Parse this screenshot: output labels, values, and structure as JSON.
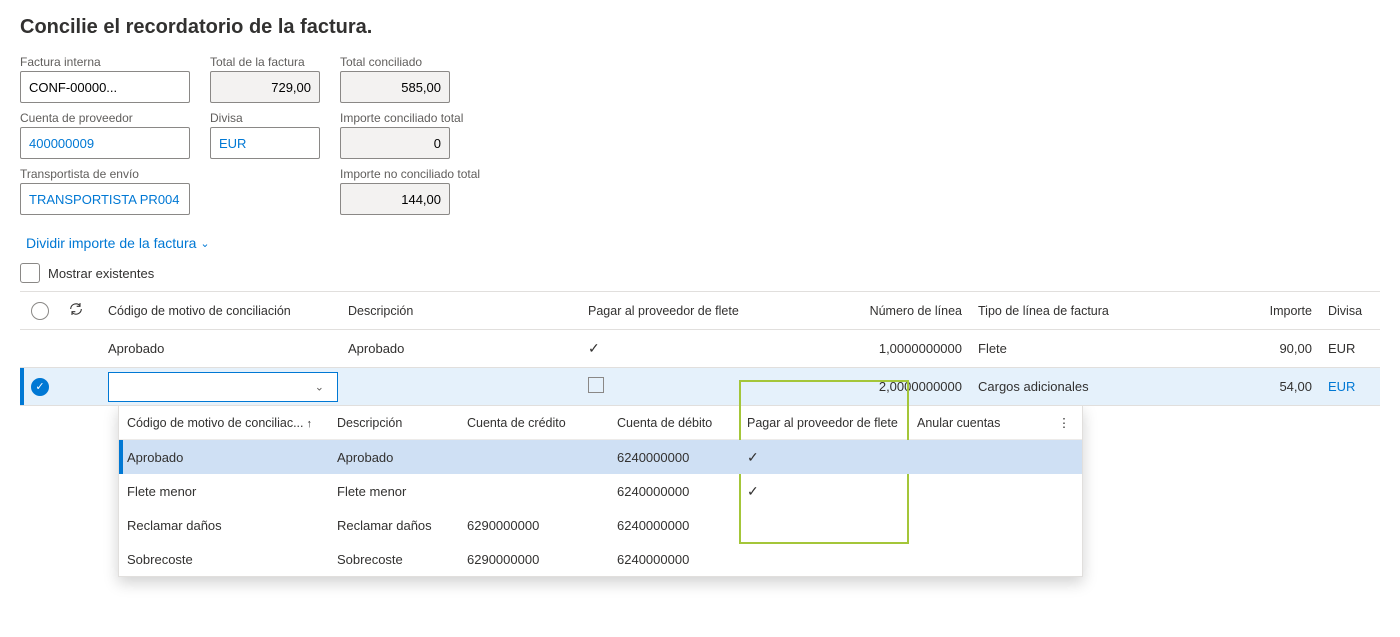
{
  "title": "Concilie el recordatorio de la factura.",
  "labels": {
    "factura_interna": "Factura interna",
    "total_factura": "Total de la factura",
    "total_conciliado": "Total conciliado",
    "cuenta_proveedor": "Cuenta de proveedor",
    "divisa": "Divisa",
    "importe_conc_total": "Importe conciliado total",
    "transportista": "Transportista de envío",
    "importe_no_conc_total": "Importe no conciliado total"
  },
  "values": {
    "factura_interna": "CONF-00000...",
    "total_factura": "729,00",
    "total_conciliado": "585,00",
    "cuenta_proveedor": "400000009",
    "divisa": "EUR",
    "importe_conc_total": "0",
    "transportista": "TRANSPORTISTA PR004",
    "importe_no_conc_total": "144,00"
  },
  "actions": {
    "dividir": "Dividir importe de la factura",
    "mostrar_existentes": "Mostrar existentes"
  },
  "grid": {
    "headers": {
      "codigo": "Código de motivo de conciliación",
      "descripcion": "Descripción",
      "pagar_flete": "Pagar al proveedor de flete",
      "numero_linea": "Número de línea",
      "tipo_linea": "Tipo de línea de factura",
      "importe": "Importe",
      "divisa": "Divisa"
    },
    "rows": [
      {
        "selected": false,
        "codigo": "Aprobado",
        "descripcion": "Aprobado",
        "pagar_flete": true,
        "numero_linea": "1,0000000000",
        "tipo_linea": "Flete",
        "importe": "90,00",
        "divisa": "EUR"
      },
      {
        "selected": true,
        "codigo": "",
        "descripcion": "",
        "pagar_flete": false,
        "numero_linea": "2,0000000000",
        "tipo_linea": "Cargos adicionales",
        "importe": "54,00",
        "divisa": "EUR",
        "divisa_link": true,
        "editing": true
      }
    ]
  },
  "dropdown": {
    "headers": {
      "codigo": "Código de motivo de conciliac...",
      "descripcion": "Descripción",
      "cuenta_credito": "Cuenta de crédito",
      "cuenta_debito": "Cuenta de débito",
      "pagar_flete": "Pagar al proveedor de flete",
      "anular": "Anular cuentas"
    },
    "rows": [
      {
        "codigo": "Aprobado",
        "descripcion": "Aprobado",
        "credito": "",
        "debito": "6240000000",
        "pagar": true,
        "anular": "",
        "selected": true
      },
      {
        "codigo": "Flete menor",
        "descripcion": "Flete menor",
        "credito": "",
        "debito": "6240000000",
        "pagar": true,
        "anular": ""
      },
      {
        "codigo": "Reclamar daños",
        "descripcion": "Reclamar daños",
        "credito": "6290000000",
        "debito": "6240000000",
        "pagar": false,
        "anular": ""
      },
      {
        "codigo": "Sobrecoste",
        "descripcion": "Sobrecoste",
        "credito": "6290000000",
        "debito": "6240000000",
        "pagar": false,
        "anular": ""
      }
    ]
  }
}
